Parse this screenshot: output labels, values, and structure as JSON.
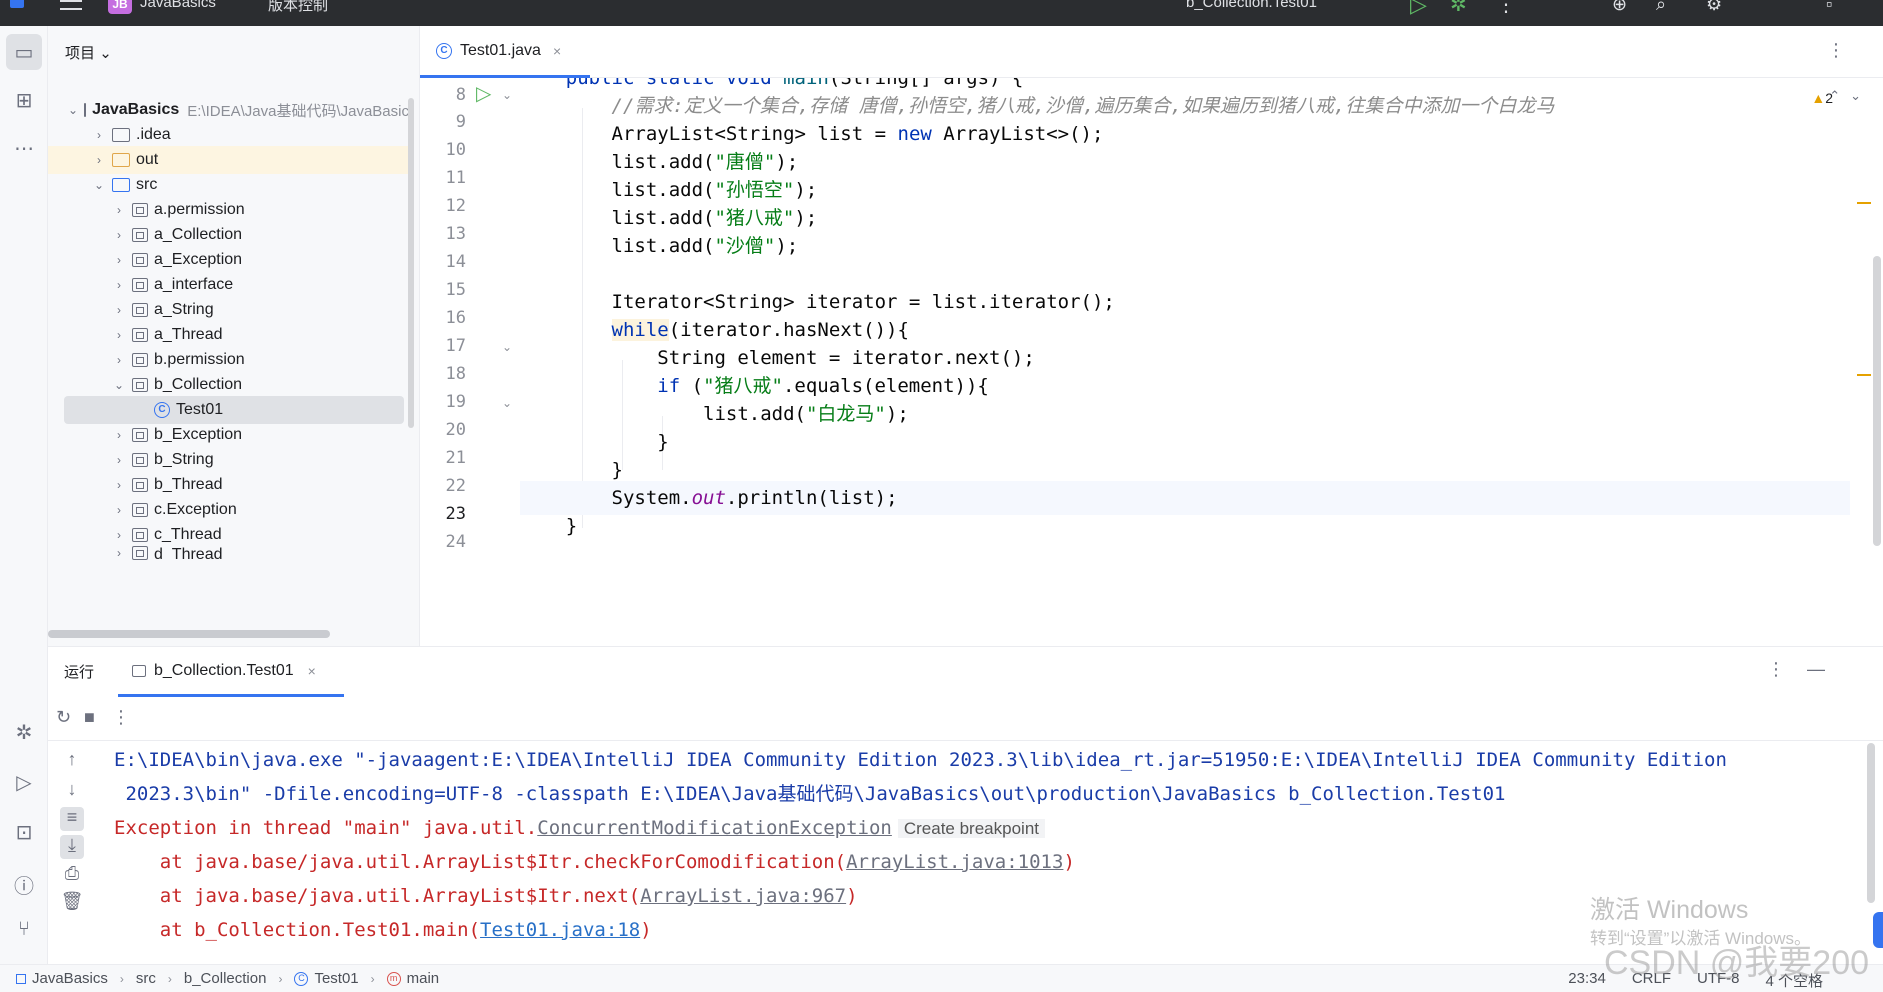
{
  "titlebar": {
    "project_badge": "JB",
    "project_name": "JavaBasics",
    "vcs_label": "版本控制",
    "run_config": "b_Collection.Test01"
  },
  "project_panel": {
    "header": "项目",
    "root_name": "JavaBasics",
    "root_path": "E:\\IDEA\\Java基础代码\\JavaBasics",
    "items": [
      {
        "label": ".idea"
      },
      {
        "label": "out"
      },
      {
        "label": "src"
      },
      {
        "label": "a.permission"
      },
      {
        "label": "a_Collection"
      },
      {
        "label": "a_Exception"
      },
      {
        "label": "a_interface"
      },
      {
        "label": "a_String"
      },
      {
        "label": "a_Thread"
      },
      {
        "label": "b.permission"
      },
      {
        "label": "b_Collection"
      },
      {
        "label": "Test01"
      },
      {
        "label": "b_Exception"
      },
      {
        "label": "b_String"
      },
      {
        "label": "b_Thread"
      },
      {
        "label": "c.Exception"
      },
      {
        "label": "c_Thread"
      },
      {
        "label": "d_Thread"
      }
    ]
  },
  "editor": {
    "tab_label": "Test01.java",
    "warning_count": "2",
    "line_numbers": [
      "8",
      "9",
      "10",
      "11",
      "12",
      "13",
      "14",
      "15",
      "16",
      "17",
      "18",
      "19",
      "20",
      "21",
      "22",
      "23",
      "24"
    ],
    "code": {
      "l8_a": "public static void ",
      "l8_b": "main",
      "l8_c": "(String[] args) {",
      "l9": "//需求:定义一个集合,存储 唐僧,孙悟空,猪八戒,沙僧,遍历集合,如果遍历到猪八戒,往集合中添加一个白龙马",
      "l10_a": "ArrayList<String> list = ",
      "l10_b": "new",
      "l10_c": " ArrayList<>();",
      "l11_a": "list.add(",
      "l11_s": "\"唐僧\"",
      "l12_s": "\"孙悟空\"",
      "l13_s": "\"猪八戒\"",
      "l14_s": "\"沙僧\"",
      "l_end": ");",
      "l16": "Iterator<String> iterator = list.iterator();",
      "l17_a": "while",
      "l17_b": "(iterator.hasNext()){",
      "l18": "String element = iterator.next();",
      "l19_a": "if",
      "l19_b": " (",
      "l19_s": "\"猪八戒\"",
      "l19_c": ".equals(element)){",
      "l20_s": "\"白龙马\"",
      "brace": "}",
      "l23_a": "System.",
      "l23_b": "out",
      "l23_c": ".println(list);"
    }
  },
  "run_panel": {
    "title": "运行",
    "tab_label": "b_Collection.Test01",
    "console": {
      "cmd1": "E:\\IDEA\\bin\\java.exe \"-javaagent:E:\\IDEA\\IntelliJ IDEA Community Edition 2023.3\\lib\\idea_rt.jar=51950:E:\\IDEA\\IntelliJ IDEA Community Edition",
      "cmd2": " 2023.3\\bin\" -Dfile.encoding=UTF-8 -classpath E:\\IDEA\\Java基础代码\\JavaBasics\\out\\production\\JavaBasics b_Collection.Test01",
      "exc_prefix": "Exception in thread \"main\" java.util.",
      "exc_class": "ConcurrentModificationException",
      "breakpoint_hint": "Create breakpoint",
      "st1_a": "    at java.base/java.util.ArrayList$Itr.checkForComodification(",
      "st1_link": "ArrayList.java:1013",
      "st2_a": "    at java.base/java.util.ArrayList$Itr.next(",
      "st2_link": "ArrayList.java:967",
      "st3_a": "    at b_Collection.Test01.main(",
      "st3_link": "Test01.java:18",
      "close_paren": ")"
    }
  },
  "statusbar": {
    "breadcrumbs": [
      "JavaBasics",
      "src",
      "b_Collection",
      "Test01",
      "main"
    ],
    "time": "23:34",
    "line_sep": "CRLF",
    "encoding": "UTF-8",
    "indent": "4 个空格"
  },
  "watermark": {
    "line1": "激活 Windows",
    "line2": "转到“设置”以激活 Windows。",
    "csdn": "CSDN @我要200"
  },
  "colors": {
    "accent": "#3574f0",
    "keyword": "#0033b3",
    "string": "#067d17",
    "error": "#c62828"
  }
}
